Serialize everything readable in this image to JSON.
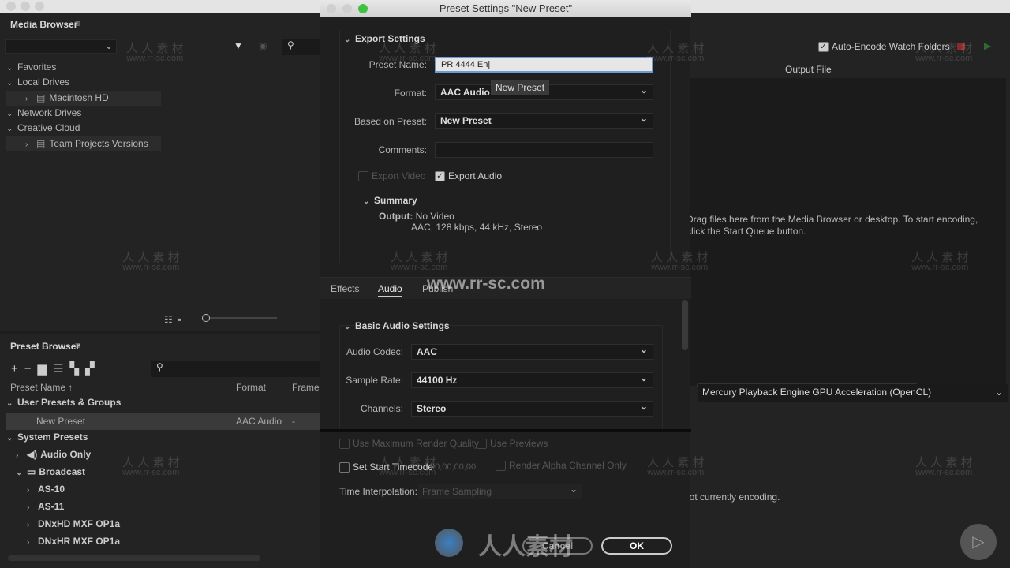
{
  "media_browser": {
    "title": "Media Browser",
    "tree": [
      {
        "label": "Favorites",
        "level": 0,
        "expanded": true
      },
      {
        "label": "Local Drives",
        "level": 0,
        "expanded": true
      },
      {
        "label": "Macintosh HD",
        "level": 1,
        "expanded": false,
        "icon": "hard-drive-icon"
      },
      {
        "label": "Network Drives",
        "level": 0,
        "expanded": true
      },
      {
        "label": "Creative Cloud",
        "level": 0,
        "expanded": true
      },
      {
        "label": "Team Projects Versions",
        "level": 1,
        "expanded": false,
        "icon": "team-projects-icon"
      }
    ]
  },
  "preset_browser": {
    "title": "Preset Browser",
    "columns": [
      "Preset Name",
      "Format",
      "Frame"
    ],
    "user_group": "User Presets & Groups",
    "user_presets": [
      {
        "name": "New Preset",
        "format": "AAC Audio",
        "frame": "-"
      }
    ],
    "system_group": "System Presets",
    "system_items": [
      {
        "label": "Audio Only",
        "level": 1,
        "icon": "speaker-icon"
      },
      {
        "label": "Broadcast",
        "level": 1,
        "icon": "tv-icon"
      },
      {
        "label": "AS-10",
        "level": 2
      },
      {
        "label": "AS-11",
        "level": 2
      },
      {
        "label": "DNxHD MXF OP1a",
        "level": 2
      },
      {
        "label": "DNxHR MXF OP1a",
        "level": 2
      }
    ]
  },
  "queue": {
    "auto_encode": "Auto-Encode Watch Folders",
    "auto_encode_checked": true,
    "output_col": "Output File",
    "empty_msg": "Drag files here from the Media Browser or desktop.  To start encoding, click the Start Queue button.",
    "renderer": "Mercury Playback Engine GPU Acceleration (OpenCL)",
    "status": "Not currently encoding."
  },
  "dialog": {
    "title": "Preset Settings \"New Preset\"",
    "export_settings": "Export Settings",
    "preset_name_label": "Preset Name:",
    "preset_name_value": "PR 4444 En",
    "tooltip": "New Preset",
    "format_label": "Format:",
    "format_value": "AAC Audio",
    "based_label": "Based on Preset:",
    "based_value": "New Preset",
    "comments_label": "Comments:",
    "comments_value": "",
    "export_video": "Export Video",
    "export_video_checked": false,
    "export_audio": "Export Audio",
    "export_audio_checked": true,
    "summary": "Summary",
    "output_label": "Output:",
    "output_line1": "No Video",
    "output_line2": "AAC, 128 kbps, 44 kHz, Stereo",
    "tabs": [
      "Effects",
      "Audio",
      "Publish"
    ],
    "active_tab": "Audio",
    "basic_audio": "Basic Audio Settings",
    "codec_label": "Audio Codec:",
    "codec_value": "AAC",
    "rate_label": "Sample Rate:",
    "rate_value": "44100 Hz",
    "channels_label": "Channels:",
    "channels_value": "Stereo",
    "max_quality": "Use Maximum Render Quality",
    "use_previews": "Use Previews",
    "start_tc": "Set Start Timecode",
    "tc_value": "00;00;00;00",
    "alpha": "Render Alpha Channel Only",
    "interp_label": "Time Interpolation:",
    "interp_value": "Frame Sampling",
    "cancel": "Cancel",
    "ok": "OK"
  },
  "watermark": {
    "cn": "人 人 素 材",
    "url": "www.rr-sc.com",
    "big_url": "www.rr-sc.com",
    "logo": "人人素材"
  }
}
